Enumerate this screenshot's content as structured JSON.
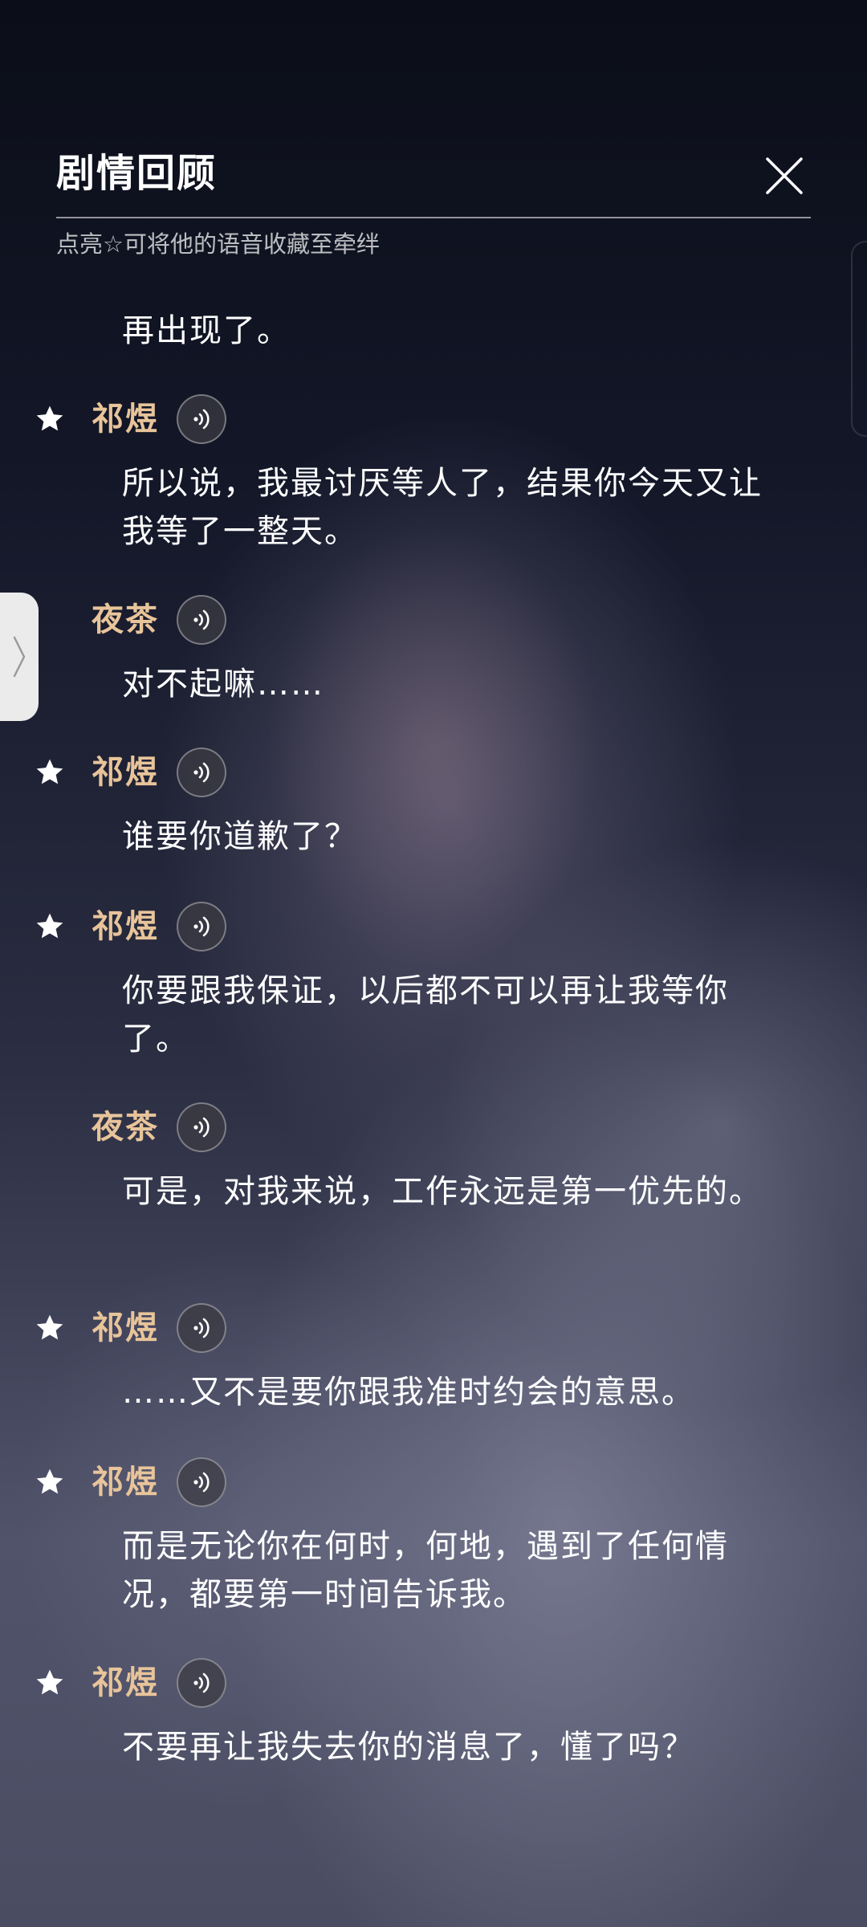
{
  "header": {
    "title": "剧情回顾",
    "hint": "点亮☆可将他的语音收藏至牵绊"
  },
  "side_tab": {
    "glyph": "⟩"
  },
  "dialog": [
    {
      "text": "再出现了。"
    },
    {
      "speaker": "祁煜",
      "starred": true,
      "text": "所以说，我最讨厌等人了，结果你今天又让我等了一整天。"
    },
    {
      "speaker": "夜茶",
      "starred": false,
      "text": "对不起嘛……"
    },
    {
      "speaker": "祁煜",
      "starred": true,
      "text": "谁要你道歉了？"
    },
    {
      "speaker": "祁煜",
      "starred": true,
      "text": "你要跟我保证，以后都不可以再让我等你了。"
    },
    {
      "speaker": "夜茶",
      "starred": false,
      "text": "可是，对我来说，工作永远是第一优先的。"
    },
    {
      "speaker": "祁煜",
      "starred": true,
      "text": "……又不是要你跟我准时约会的意思。"
    },
    {
      "speaker": "祁煜",
      "starred": true,
      "text": "而是无论你在何时，何地，遇到了任何情况，都要第一时间告诉我。"
    },
    {
      "speaker": "祁煜",
      "starred": true,
      "text": "不要再让我失去你的消息了，懂了吗？"
    }
  ],
  "colors": {
    "speaker": "#e8c49a",
    "text": "#ffffff",
    "star": "#ffffff"
  },
  "icons": {
    "close": "close-icon",
    "star": "star-icon",
    "voice": "voice-play-icon",
    "side_tab": "chevron-right-icon"
  }
}
